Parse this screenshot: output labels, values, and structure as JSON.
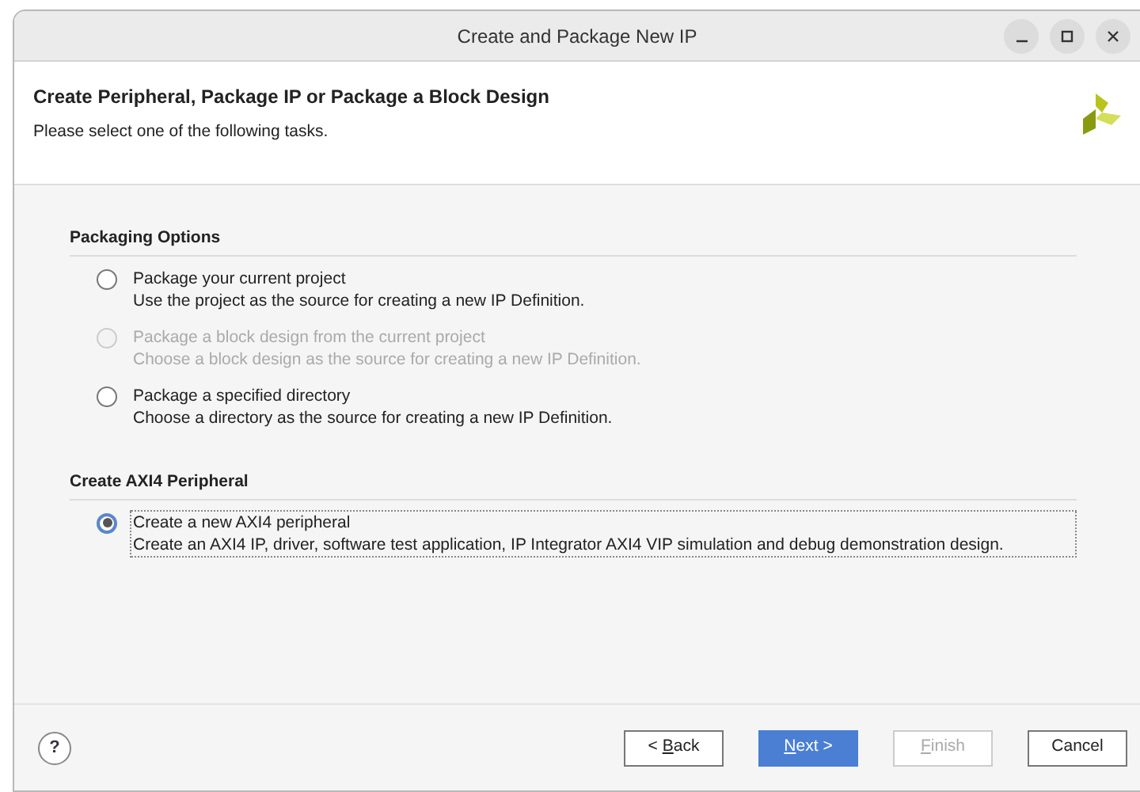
{
  "window": {
    "title": "Create and Package New IP"
  },
  "header": {
    "title": "Create Peripheral, Package IP or Package a Block Design",
    "subtitle": "Please select one of the following tasks."
  },
  "groups": [
    {
      "title": "Packaging Options",
      "options": [
        {
          "label": "Package your current project",
          "description": "Use the project as the source for creating a new IP Definition.",
          "selected": false,
          "disabled": false
        },
        {
          "label": "Package a block design from the current project",
          "description": "Choose a block design as the source for creating a new IP Definition.",
          "selected": false,
          "disabled": true
        },
        {
          "label": "Package a specified directory",
          "description": "Choose a directory as the source for creating a new IP Definition.",
          "selected": false,
          "disabled": false
        }
      ]
    },
    {
      "title": "Create AXI4 Peripheral",
      "options": [
        {
          "label": "Create a new AXI4 peripheral",
          "description": "Create an AXI4 IP, driver, software test application, IP Integrator AXI4 VIP simulation and debug demonstration design.",
          "selected": true,
          "disabled": false
        }
      ]
    }
  ],
  "help": {
    "label": "?"
  },
  "buttons": [
    {
      "label": {
        "before": "< ",
        "key": "B",
        "after": "ack"
      },
      "kind": "normal",
      "disabled": false
    },
    {
      "label": {
        "key": "N",
        "after": "ext >"
      },
      "kind": "primary",
      "disabled": false
    },
    {
      "label": {
        "key": "F",
        "after": "inish"
      },
      "kind": "normal",
      "disabled": true
    },
    {
      "label": {
        "before": "Cancel"
      },
      "kind": "normal",
      "disabled": false
    }
  ]
}
